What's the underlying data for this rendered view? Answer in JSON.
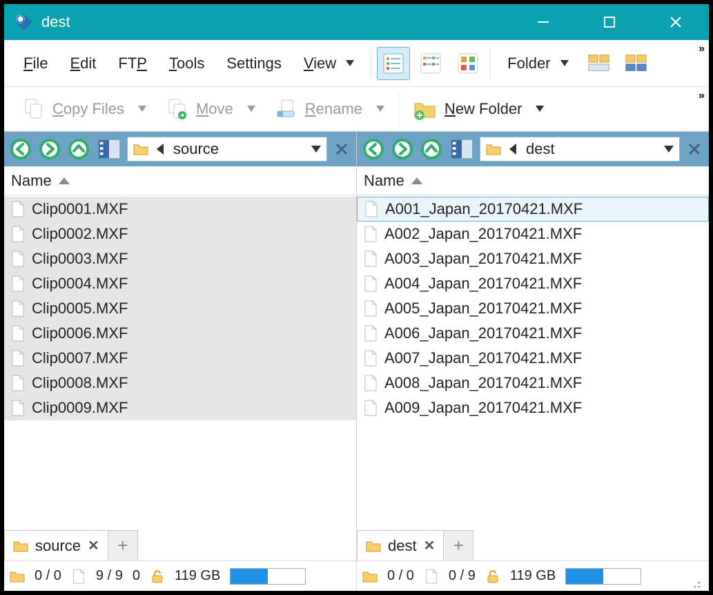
{
  "title": "dest",
  "menu": {
    "file": "File",
    "edit": "Edit",
    "ftp": "FTP",
    "tools": "Tools",
    "settings": "Settings",
    "view": "View",
    "folder": "Folder"
  },
  "ops": {
    "copy": "Copy Files",
    "move": "Move",
    "rename": "Rename",
    "newfolder": "New Folder"
  },
  "panes": {
    "left": {
      "path": "source",
      "header": "Name",
      "tab": "source",
      "files": [
        "Clip0001.MXF",
        "Clip0002.MXF",
        "Clip0003.MXF",
        "Clip0004.MXF",
        "Clip0005.MXF",
        "Clip0006.MXF",
        "Clip0007.MXF",
        "Clip0008.MXF",
        "Clip0009.MXF"
      ]
    },
    "right": {
      "path": "dest",
      "header": "Name",
      "tab": "dest",
      "files": [
        "A001_Japan_20170421.MXF",
        "A002_Japan_20170421.MXF",
        "A003_Japan_20170421.MXF",
        "A004_Japan_20170421.MXF",
        "A005_Japan_20170421.MXF",
        "A006_Japan_20170421.MXF",
        "A007_Japan_20170421.MXF",
        "A008_Japan_20170421.MXF",
        "A009_Japan_20170421.MXF"
      ]
    }
  },
  "status": {
    "left": {
      "folders": "0 / 0",
      "files": "9 / 9",
      "sel": "0",
      "disk": "119 GB",
      "fill_pct": 50
    },
    "right": {
      "folders": "0 / 0",
      "files": "0 / 9",
      "disk": "119 GB",
      "fill_pct": 50
    }
  }
}
